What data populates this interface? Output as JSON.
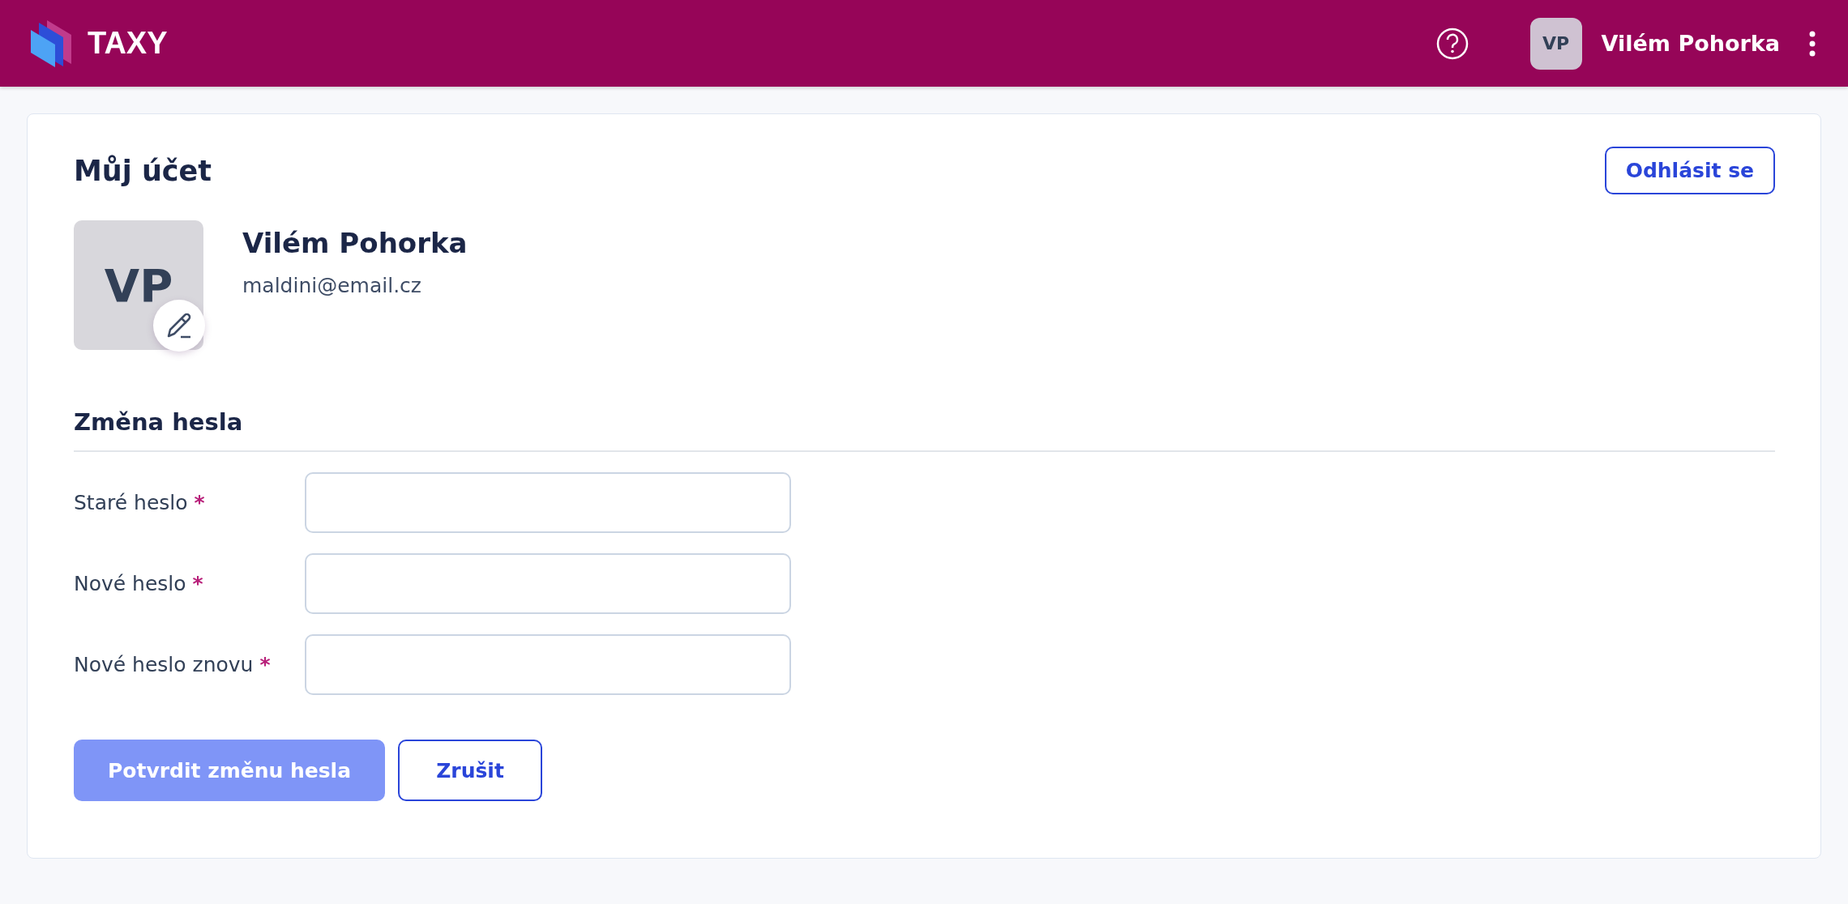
{
  "header": {
    "brand": "TAXY",
    "user_initials": "VP",
    "user_name": "Vilém Pohorka"
  },
  "card": {
    "title": "Můj účet",
    "logout": "Odhlásit se",
    "profile": {
      "initials": "VP",
      "name": "Vilém Pohorka",
      "email": "maldini@email.cz"
    },
    "section_title": "Změna hesla",
    "fields": [
      {
        "label": "Staré heslo",
        "required_mark": "*",
        "required": true
      },
      {
        "label": "Nové heslo",
        "required_mark": "*",
        "required": true
      },
      {
        "label": "Nové heslo znovu",
        "required_mark": "*",
        "required": true
      }
    ],
    "submit": {
      "label": "Potvrdit změnu hesla",
      "disabled": true
    },
    "cancel": "Zrušit"
  }
}
